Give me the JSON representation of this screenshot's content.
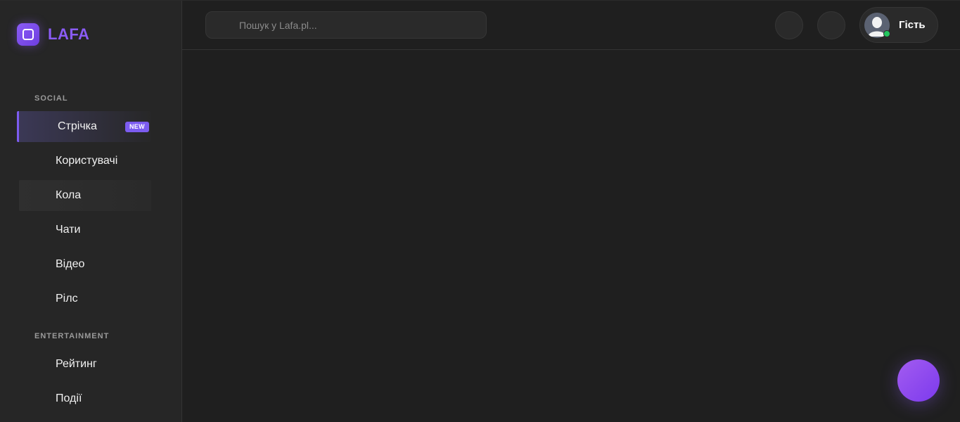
{
  "brand": {
    "name": "LAFA",
    "accent_color": "#8b5cf6"
  },
  "sidebar": {
    "sections": [
      {
        "title": "SOCIAL",
        "items": [
          {
            "label": "Стрічка",
            "badge": "NEW",
            "active": true
          },
          {
            "label": "Користувачі"
          },
          {
            "label": "Кола",
            "hovered": true
          },
          {
            "label": "Чати"
          },
          {
            "label": "Відео"
          },
          {
            "label": "Рілс"
          }
        ]
      },
      {
        "title": "ENTERTAINMENT",
        "items": [
          {
            "label": "Рейтинг"
          },
          {
            "label": "Події"
          }
        ]
      }
    ]
  },
  "header": {
    "search": {
      "placeholder": "Пошук у Lafa.pl...",
      "value": ""
    },
    "profile": {
      "name": "Гість",
      "status_color": "#22c55e"
    }
  }
}
